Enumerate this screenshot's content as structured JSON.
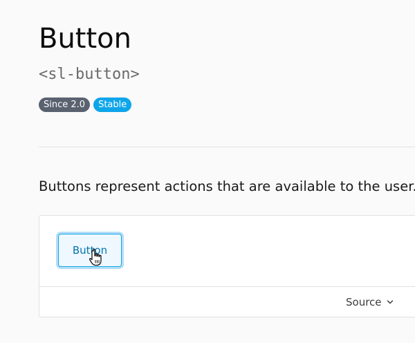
{
  "header": {
    "title": "Button",
    "tag_name": "<sl-button>",
    "badges": [
      {
        "label": "Since 2.0",
        "color": "#5a6270"
      },
      {
        "label": "Stable",
        "color": "#0ea5e9"
      }
    ]
  },
  "description": "Buttons represent actions that are available to the user.",
  "example": {
    "button_label": "Button",
    "source_label": "Source",
    "accent_color": "#0ea5e9"
  },
  "icons": {
    "cursor": "pointer-hand-icon",
    "source_toggle": "chevron-down-icon"
  }
}
